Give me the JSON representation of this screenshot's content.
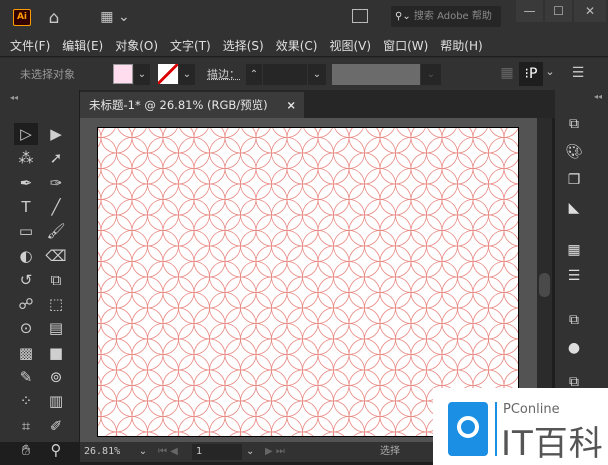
{
  "app": {
    "logo": "Ai",
    "search_placeholder": "搜索 Adobe 帮助"
  },
  "menu": [
    "文件(F)",
    "编辑(E)",
    "对象(O)",
    "文字(T)",
    "选择(S)",
    "效果(C)",
    "视图(V)",
    "窗口(W)",
    "帮助(H)"
  ],
  "control": {
    "selection_status": "未选择对象",
    "stroke_label": "描边："
  },
  "document": {
    "tab_title": "未标题-1* @ 26.81% (RGB/预览)",
    "close": "×"
  },
  "status": {
    "zoom": "26.81%",
    "artboard_number": "1",
    "tool_name": "选择"
  },
  "watermark": {
    "brand": "PConline",
    "name": "IT百科"
  },
  "colors": {
    "pattern_stroke": "#e88a84",
    "accent_blue": "#1a8fe3"
  },
  "tools": [
    "selection",
    "direct-selection",
    "magic-wand",
    "lasso",
    "pen",
    "curvature",
    "type",
    "line",
    "rectangle",
    "paintbrush",
    "shaper",
    "eraser",
    "rotate",
    "scale",
    "puppet-warp",
    "free-transform",
    "shape-builder",
    "perspective-grid",
    "mesh",
    "gradient",
    "eyedropper",
    "blend",
    "symbol-sprayer",
    "column-graph",
    "artboard",
    "slice",
    "hand",
    "zoom"
  ]
}
